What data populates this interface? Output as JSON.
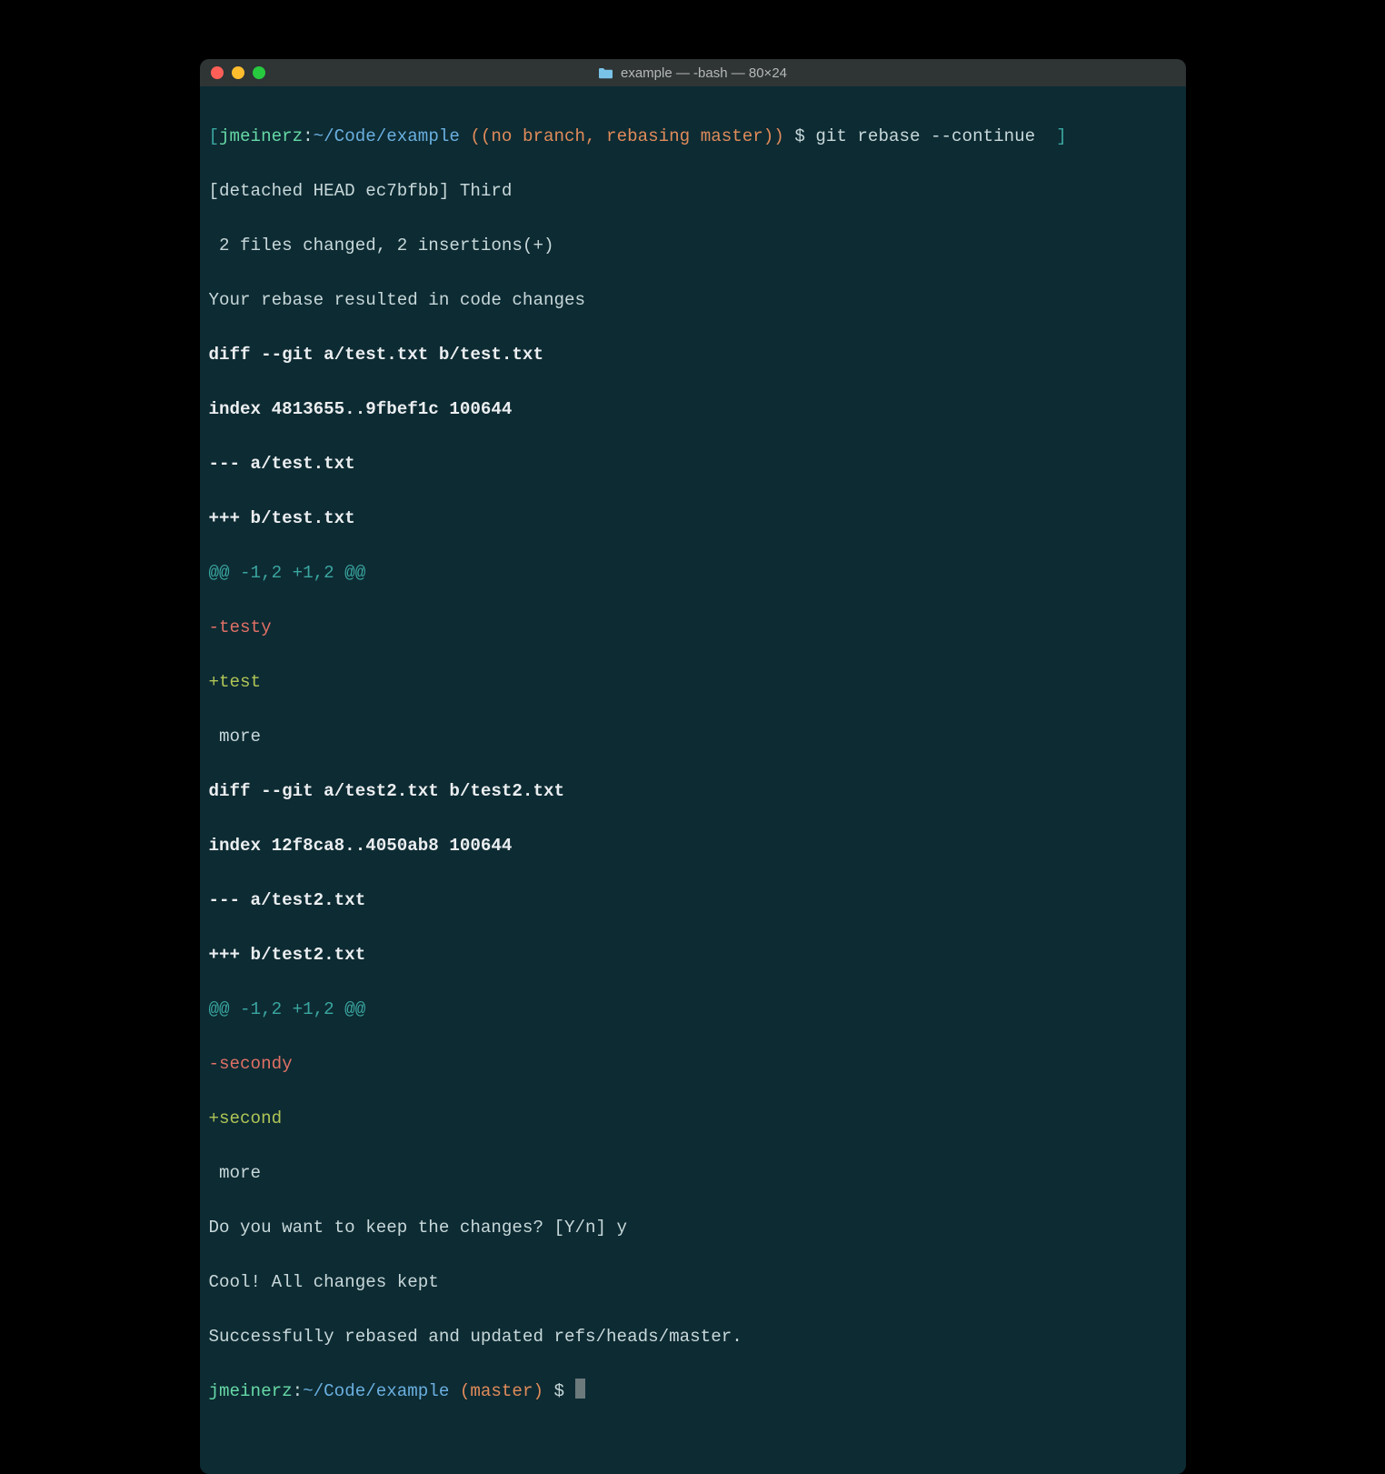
{
  "window": {
    "title": "example — -bash — 80×24"
  },
  "prompt1": {
    "open_bracket": "[",
    "user": "jmeinerz",
    "sep": ":",
    "path": "~/Code/example",
    "branch": " ((no branch, rebasing master))",
    "dollar": " $ ",
    "command": "git rebase --continue",
    "close_bracket": "  ]"
  },
  "lines": {
    "l1": "[detached HEAD ec7bfbb] Third",
    "l2": " 2 files changed, 2 insertions(+)",
    "l3": "Your rebase resulted in code changes",
    "l4": "diff --git a/test.txt b/test.txt",
    "l5": "index 4813655..9fbef1c 100644",
    "l6": "--- a/test.txt",
    "l7": "+++ b/test.txt",
    "l8": "@@ -1,2 +1,2 @@",
    "l9": "-testy",
    "l10": "+test",
    "l11": " more",
    "l12": "diff --git a/test2.txt b/test2.txt",
    "l13": "index 12f8ca8..4050ab8 100644",
    "l14": "--- a/test2.txt",
    "l15": "+++ b/test2.txt",
    "l16": "@@ -1,2 +1,2 @@",
    "l17": "-secondy",
    "l18": "+second",
    "l19": " more",
    "l20": "Do you want to keep the changes? [Y/n] y",
    "l21": "Cool! All changes kept",
    "l22": "Successfully rebased and updated refs/heads/master."
  },
  "prompt2": {
    "user": "jmeinerz",
    "sep": ":",
    "path": "~/Code/example",
    "branch": " (master)",
    "dollar": " $ "
  }
}
